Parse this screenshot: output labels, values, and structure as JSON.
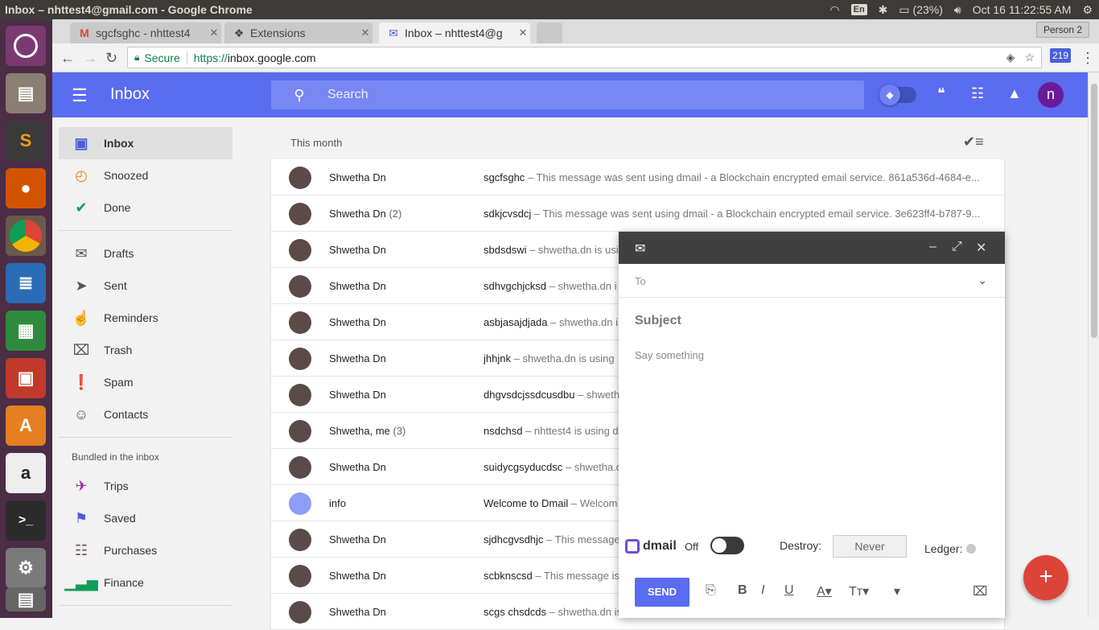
{
  "os": {
    "window_title": "Inbox – nhttest4@gmail.com - Google Chrome",
    "input_lang": "En",
    "battery": "(23%)",
    "clock": "Oct 16 11:22:55 AM"
  },
  "browser": {
    "tabs": [
      {
        "label": "sgcfsghc - nhttest4",
        "icon": "gmail-icon"
      },
      {
        "label": "Extensions",
        "icon": "puzzle-icon"
      },
      {
        "label": "Inbox – nhttest4@g",
        "icon": "inbox-icon"
      }
    ],
    "person": "Person 2",
    "secure_label": "Secure",
    "url_scheme": "https://",
    "url_host": "inbox.google.com",
    "ext_badge": "219"
  },
  "app": {
    "title": "Inbox",
    "search_placeholder": "Search",
    "avatar_letter": "n"
  },
  "sidebar": {
    "items": [
      {
        "label": "Inbox",
        "icon": "inbox-icon"
      },
      {
        "label": "Snoozed",
        "icon": "clock-icon"
      },
      {
        "label": "Done",
        "icon": "check-icon"
      },
      {
        "label": "Drafts",
        "icon": "drafts-icon"
      },
      {
        "label": "Sent",
        "icon": "send-icon"
      },
      {
        "label": "Reminders",
        "icon": "hand-icon"
      },
      {
        "label": "Trash",
        "icon": "trash-icon"
      },
      {
        "label": "Spam",
        "icon": "alert-icon"
      },
      {
        "label": "Contacts",
        "icon": "contact-icon"
      }
    ],
    "bundled_title": "Bundled in the inbox",
    "bundles": [
      {
        "label": "Trips",
        "icon": "plane-icon"
      },
      {
        "label": "Saved",
        "icon": "bookmark-icon"
      },
      {
        "label": "Purchases",
        "icon": "cart-icon"
      },
      {
        "label": "Finance",
        "icon": "chart-icon"
      }
    ]
  },
  "list": {
    "month_label": "This month",
    "rows": [
      {
        "sender": "Shwetha Dn",
        "count": "",
        "subject": "sgcfsghc",
        "preview": " – This message was sent using dmail - a Blockchain encrypted email service. 861a536d-4684-e..."
      },
      {
        "sender": "Shwetha Dn",
        "count": "(2)",
        "subject": "sdkjcvsdcj",
        "preview": " – This message was sent using dmail - a Blockchain encrypted email service. 3e623ff4-b787-9..."
      },
      {
        "sender": "Shwetha Dn",
        "count": "",
        "subject": "sbdsdswi",
        "preview": " – shwetha.dn is usi"
      },
      {
        "sender": "Shwetha Dn",
        "count": "",
        "subject": "sdhvgchjcksd",
        "preview": " – shwetha.dn i"
      },
      {
        "sender": "Shwetha Dn",
        "count": "",
        "subject": "asbjasajdjada",
        "preview": " – shwetha.dn i"
      },
      {
        "sender": "Shwetha Dn",
        "count": "",
        "subject": "jhhjnk",
        "preview": " – shwetha.dn is using"
      },
      {
        "sender": "Shwetha Dn",
        "count": "",
        "subject": "dhgvsdcjssdcusdbu",
        "preview": " – shweth"
      },
      {
        "sender": "Shwetha, me",
        "count": "(3)",
        "subject": "nsdchsd",
        "preview": " – nhttest4 is using d"
      },
      {
        "sender": "Shwetha Dn",
        "count": "",
        "subject": "suidycgsyducdsc",
        "preview": " – shwetha.d"
      },
      {
        "sender": "info",
        "count": "",
        "subject": "Welcome to Dmail",
        "preview": " – Welcom"
      },
      {
        "sender": "Shwetha Dn",
        "count": "",
        "subject": "sjdhcgvsdhjc",
        "preview": " – This message"
      },
      {
        "sender": "Shwetha Dn",
        "count": "",
        "subject": "scbknscsd",
        "preview": " – This message is"
      },
      {
        "sender": "Shwetha Dn",
        "count": "",
        "subject": "scgs chsdcds",
        "preview": " – shwetha.dn is u"
      }
    ]
  },
  "compose": {
    "to_label": "To",
    "subject_placeholder": "Subject",
    "body_placeholder": "Say something",
    "brand": "dmail",
    "toggle_state": "Off",
    "destroy_label": "Destroy:",
    "destroy_value": "Never",
    "ledger_label": "Ledger:",
    "send_label": "SEND"
  },
  "fab_label": "+"
}
